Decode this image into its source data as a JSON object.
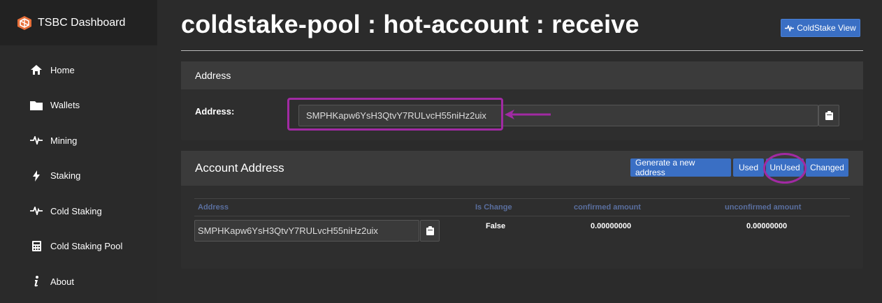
{
  "sidebar": {
    "brand": "TSBC Dashboard",
    "items": [
      {
        "label": "Home",
        "icon": "home-icon"
      },
      {
        "label": "Wallets",
        "icon": "folder-icon"
      },
      {
        "label": "Mining",
        "icon": "pulse-icon"
      },
      {
        "label": "Staking",
        "icon": "bolt-icon"
      },
      {
        "label": "Cold Staking",
        "icon": "pulse-icon"
      },
      {
        "label": "Cold Staking Pool",
        "icon": "calculator-icon"
      },
      {
        "label": "About",
        "icon": "info-icon"
      }
    ]
  },
  "header": {
    "title": "coldstake-pool : hot-account : receive",
    "view_button": "ColdStake View"
  },
  "address_panel": {
    "heading": "Address",
    "label": "Address:",
    "value": "SMPHKapw6YsH3QtvY7RULvcH55niHz2uix"
  },
  "account_panel": {
    "heading": "Account Address",
    "buttons": {
      "generate": "Generate a new address",
      "used": "Used",
      "unused": "UnUsed",
      "changed": "Changed"
    },
    "columns": {
      "address": "Address",
      "is_change": "Is Change",
      "confirmed": "confirmed amount",
      "unconfirmed": "unconfirmed amount"
    },
    "rows": [
      {
        "address": "SMPHKapw6YsH3QtvY7RULvcH55niHz2uix",
        "is_change": "False",
        "confirmed": "0.00000000",
        "unconfirmed": "0.00000000"
      }
    ]
  },
  "colors": {
    "accent": "#3a6fc4",
    "highlight": "#a12aa3",
    "header_label": "#5a6f9f"
  }
}
